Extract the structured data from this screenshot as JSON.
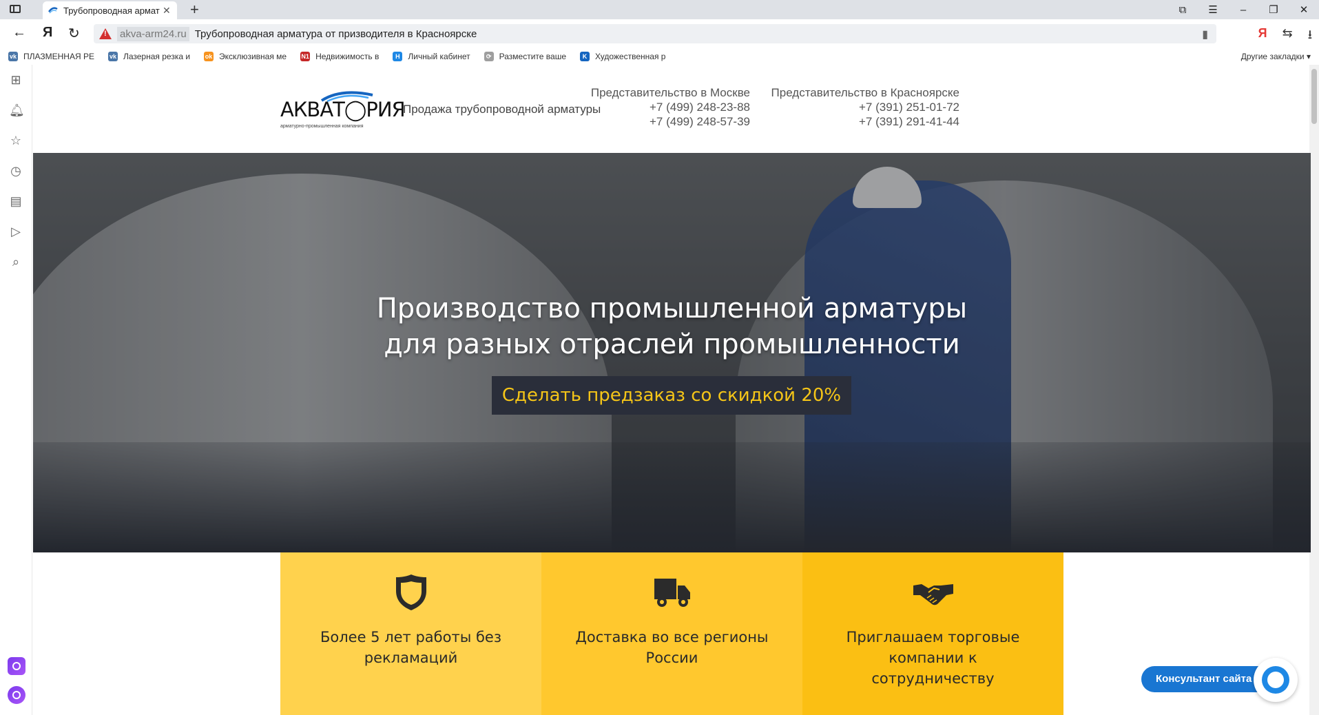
{
  "browser": {
    "tab": {
      "title": "Трубопроводная арматура",
      "close": "✕"
    },
    "new_tab": "+",
    "window_controls": [
      "⧉",
      "☰",
      "–",
      "❐",
      "✕"
    ],
    "address": {
      "domain": "akva-arm24.ru",
      "title": "Трубопроводная арматура от призводителя в Красноярске",
      "security": "warning"
    },
    "nav": {
      "back": "←",
      "yandex": "Я",
      "reload": "↻"
    },
    "tools": {
      "ya": "Я",
      "translate": "⇆",
      "download": "⭳"
    },
    "bookmarks": [
      {
        "label": "ПЛАЗМЕННАЯ РЕ",
        "icon": "vk-icon",
        "color": "#4a76a8",
        "glyph": "vk"
      },
      {
        "label": "Лазерная резка и",
        "icon": "vk-icon",
        "color": "#4a76a8",
        "glyph": "vk"
      },
      {
        "label": "Эксклюзивная ме",
        "icon": "ok-icon",
        "color": "#f7931e",
        "glyph": "ok"
      },
      {
        "label": "Недвижимость в",
        "icon": "n1-icon",
        "color": "#c62828",
        "glyph": "N1"
      },
      {
        "label": "Личный кабинет",
        "icon": "h-icon",
        "color": "#1e88e5",
        "glyph": "H"
      },
      {
        "label": "Разместите ваше",
        "icon": "rotate-icon",
        "color": "#9e9e9e",
        "glyph": "⟳"
      },
      {
        "label": "Художественная р",
        "icon": "k-icon",
        "color": "#1565c0",
        "glyph": "K"
      }
    ],
    "other_bookmarks": "Другие закладки ▾"
  },
  "sidebar_icons": [
    "grid-icon",
    "bell-icon",
    "star-icon",
    "clock-icon",
    "notes-icon",
    "play-icon",
    "search-doc-icon"
  ],
  "site": {
    "logo": {
      "word": "АКВАТ◯РИЯ",
      "sub": "арматурно-промышленная компания"
    },
    "tagline": "Продажа трубопроводной арматуры",
    "offices": [
      {
        "name": "Представительство в Москве",
        "phones": [
          "+7 (499) 248-23-88",
          "+7 (499) 248-57-39"
        ]
      },
      {
        "name": "Представительство в Красноярске",
        "phones": [
          "+7 (391) 251-01-72",
          "+7 (391) 291-41-44"
        ]
      }
    ],
    "hero": {
      "title_line1": "Производство промышленной арматуры",
      "title_line2": "для разных отраслей промышленности",
      "button": "Сделать предзаказ со скидкой 20%"
    },
    "features": [
      {
        "text": "Более 5 лет работы без рекламаций",
        "icon": "shield-icon",
        "bg": "#ffd24d"
      },
      {
        "text": "Доставка во все регионы России",
        "icon": "truck-icon",
        "bg": "#ffc82e"
      },
      {
        "text": "Приглашаем торговые компании к сотрудничеству",
        "icon": "handshake-icon",
        "bg": "#fbbf13"
      }
    ],
    "consultant": "Консультант сайта"
  },
  "colors": {
    "accent_yellow": "#f5c518",
    "button_bg": "#2a2e3a",
    "consultant_blue": "#1976d2"
  }
}
